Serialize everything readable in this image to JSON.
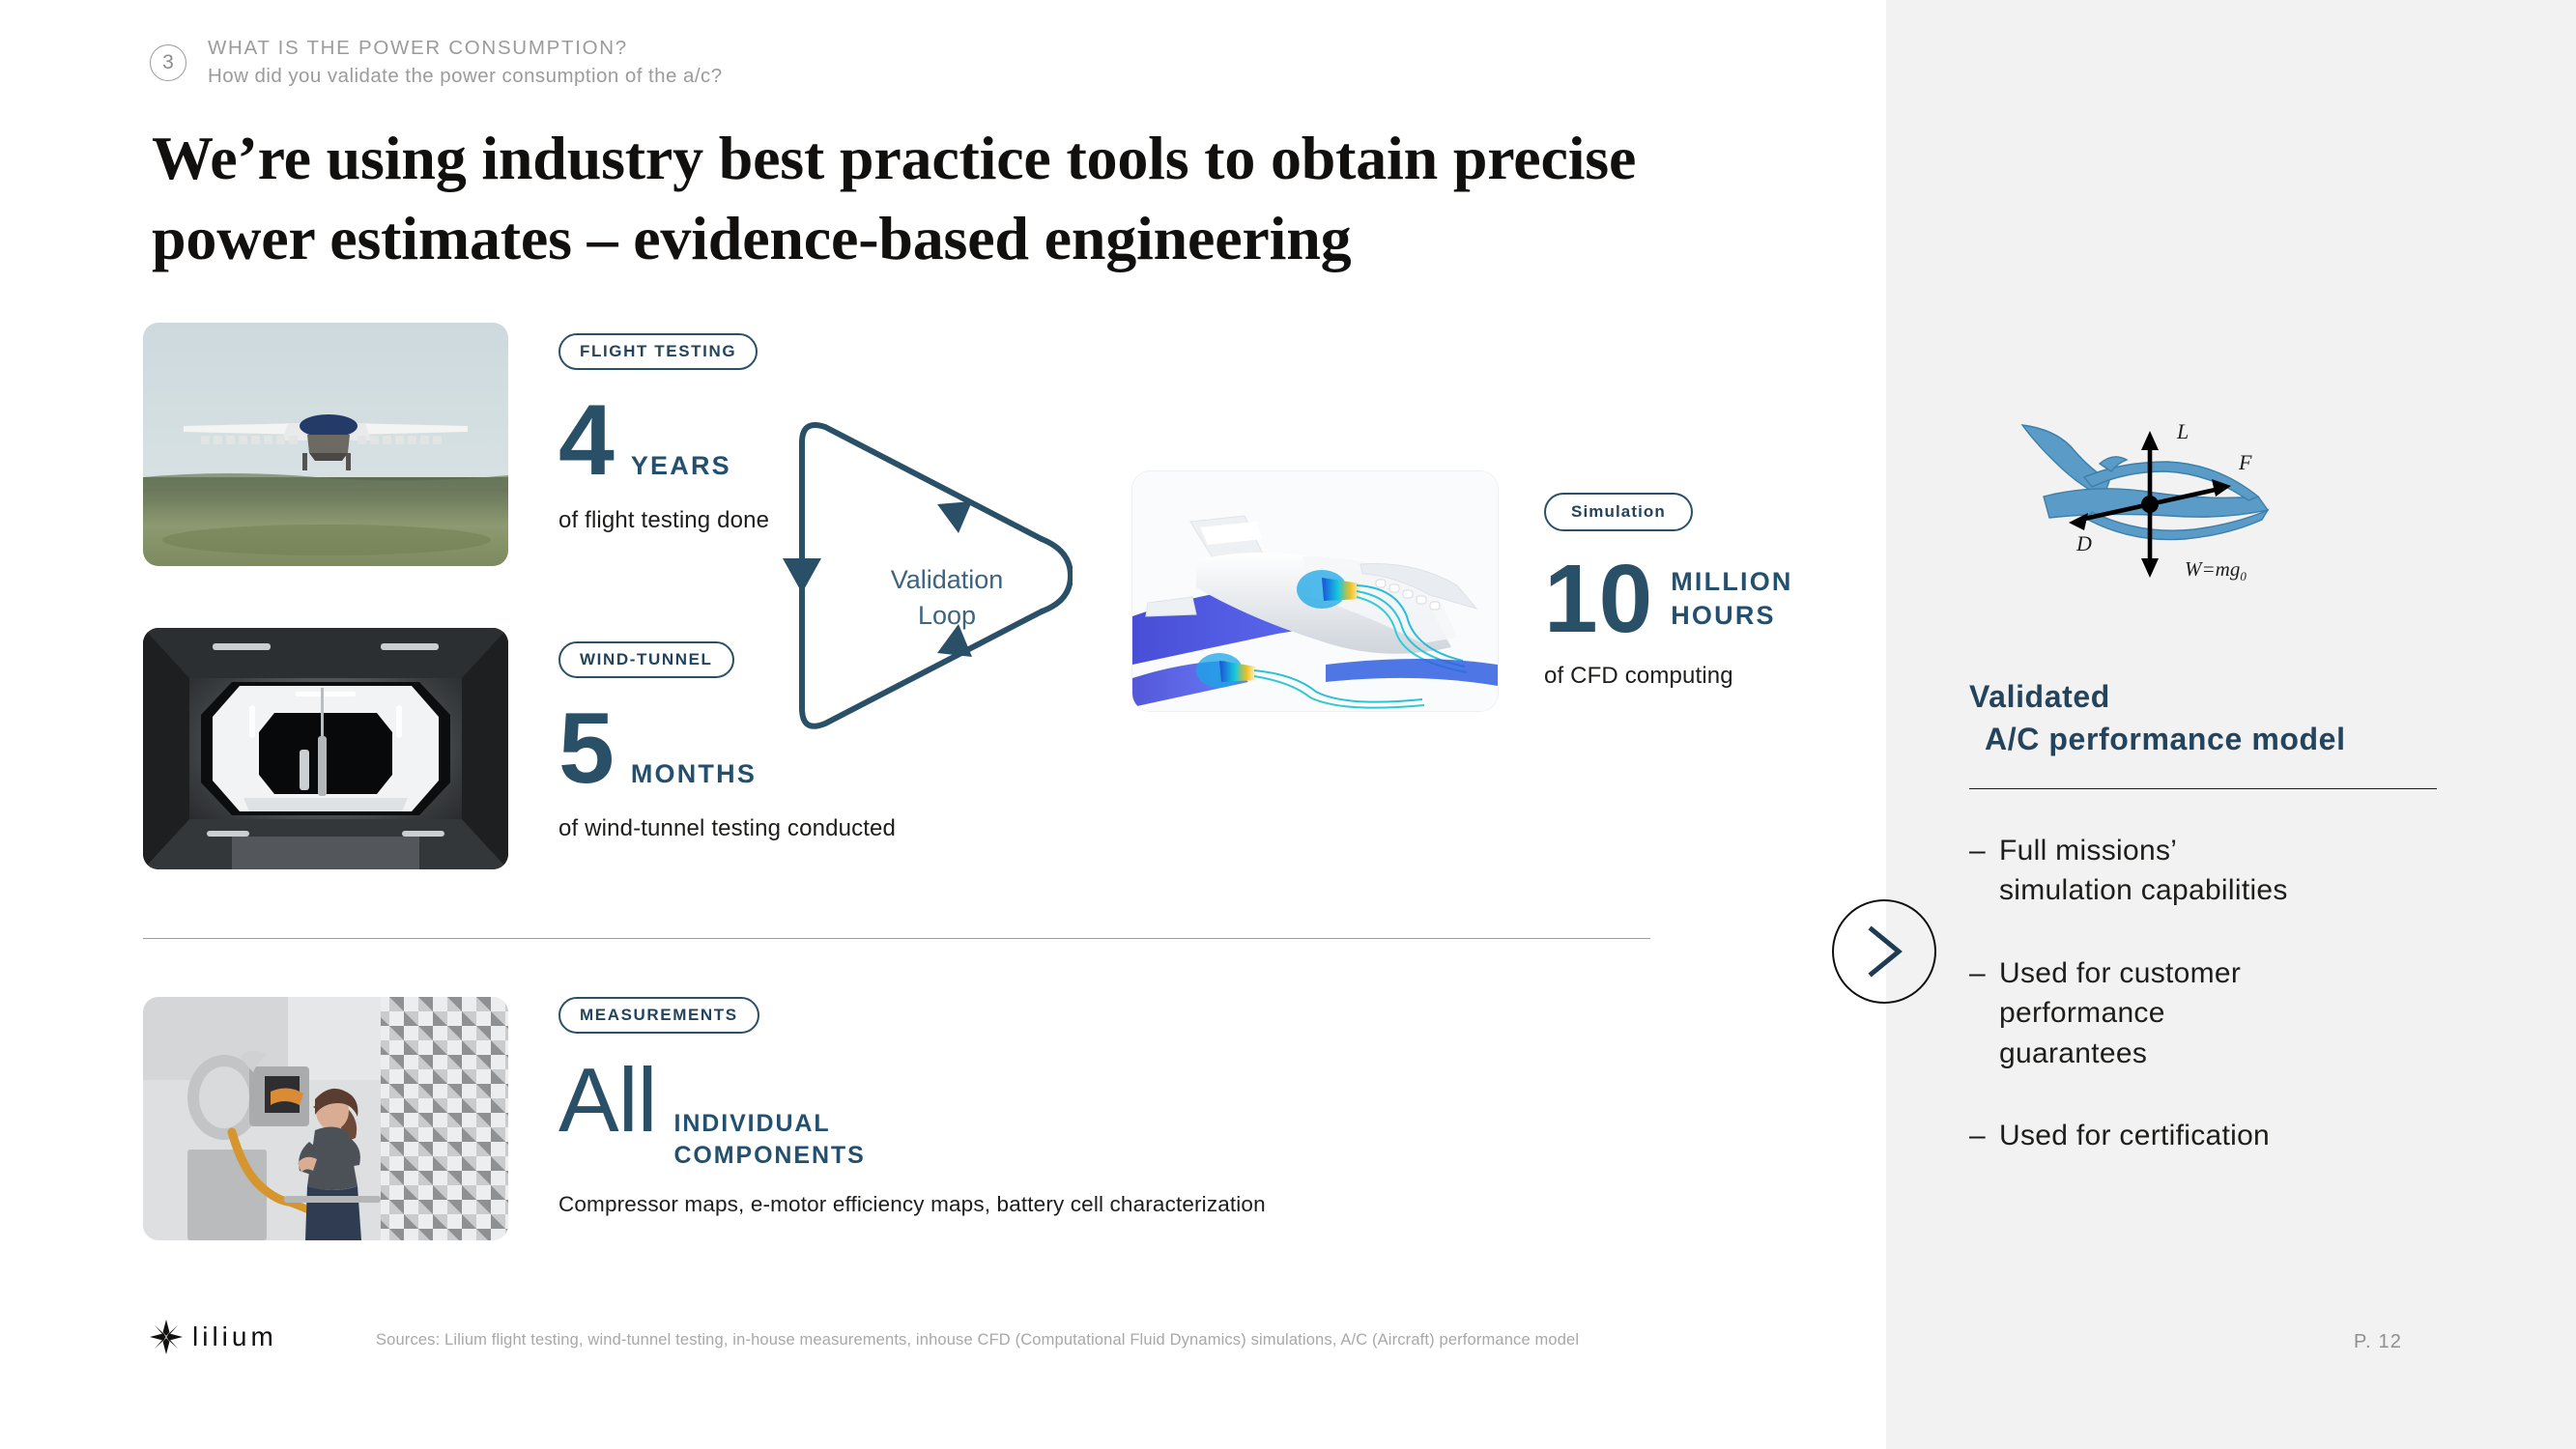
{
  "header": {
    "number": "3",
    "question_title": "WHAT IS THE POWER CONSUMPTION?",
    "question_sub": "How did you validate the power consumption of the a/c?"
  },
  "title": "We’re using industry best practice tools to obtain precise power estimates – evidence-based engineering",
  "stats": [
    {
      "badge": "FLIGHT TESTING",
      "number": "4",
      "unit": "YEARS",
      "description": "of flight testing done",
      "image": "eVTOL aircraft in flight over green terrain"
    },
    {
      "badge": "WIND-TUNNEL",
      "number": "5",
      "unit": "MONTHS",
      "description": "of wind-tunnel testing conducted",
      "image": "octagonal wind tunnel interior"
    },
    {
      "badge": "Simulation",
      "number": "10",
      "unit": "MILLION\nHOURS",
      "description": "of CFD computing",
      "image": "CFD streamline simulation of aircraft"
    },
    {
      "badge": "MEASUREMENTS",
      "number": "All",
      "unit": "INDIVIDUAL\nCOMPONENTS",
      "description": "Compressor maps, e-motor\nefficiency maps, battery cell\ncharacterization",
      "image": "engineer in anechoic chamber with test rig"
    }
  ],
  "loop": {
    "label": "Validation\nLoop"
  },
  "panel": {
    "heading_line1": "Validated",
    "heading_line2": "A/C performance model",
    "bullets": [
      {
        "dash": "–",
        "text": "Full missions’\nsimulation capabilities"
      },
      {
        "dash": "–",
        "text": "Used for customer\nperformance\nguarantees"
      },
      {
        "dash": "–",
        "text": "Used for certification"
      }
    ],
    "diagram": {
      "lift": "L",
      "thrust": "F",
      "drag": "D",
      "weight": "W=mg",
      "weight_sub": "0"
    }
  },
  "next_button": "chevron-right",
  "footer": {
    "logo_text": "lilium",
    "sources": "Sources: Lilium flight testing, wind-tunnel testing, in-house measurements, inhouse CFD (Computational Fluid Dynamics) simulations, A/C (Aircraft) performance model",
    "page": "P. 12"
  },
  "colors": {
    "accent": "#2a5068",
    "panel_bg": "#f2f2f2",
    "muted": "#9b9b9b",
    "text": "#1d1d1b"
  }
}
